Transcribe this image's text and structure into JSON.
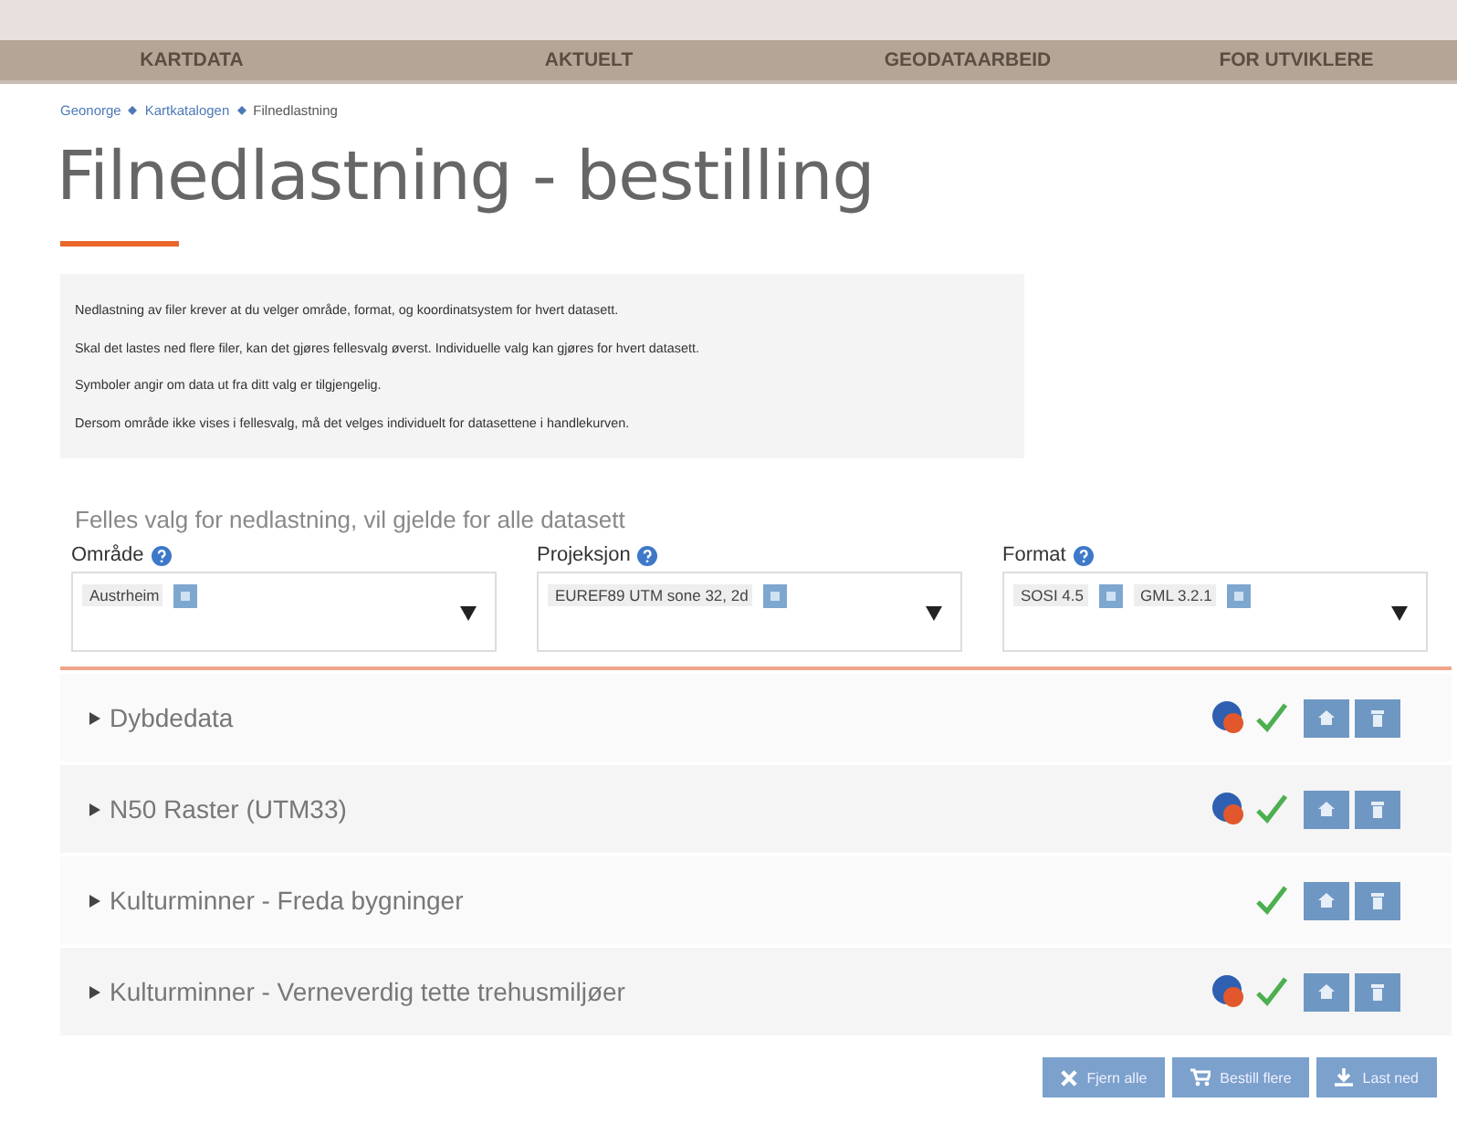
{
  "nav": [
    {
      "label": "KARTDATA"
    },
    {
      "label": "AKTUELT"
    },
    {
      "label": "GEODATAARBEID"
    },
    {
      "label": "FOR UTVIKLERE"
    }
  ],
  "breadcrumb": [
    {
      "label": "Geonorge",
      "kind": "link"
    },
    {
      "label": "Kartkatalogen",
      "kind": "link"
    },
    {
      "label": "Filnedlastning",
      "kind": "current"
    }
  ],
  "title": "Filnedlastning - bestilling",
  "info": [
    "Nedlastning av filer krever at du velger område, format, og koordinatsystem for hvert datasett.",
    "Skal det lastes ned flere filer, kan det gjøres fellesvalg øverst. Individuelle valg kan gjøres for hvert datasett.",
    "Symboler angir om data ut fra ditt valg er tilgjengelig.",
    "Dersom område ikke vises i fellesvalg, må det velges individuelt for datasettene i handlekurven."
  ],
  "common_heading": "Felles valg for nedlastning, vil gjelde for alle datasett",
  "selects": [
    {
      "label": "Område",
      "tags": [
        "Austrheim"
      ]
    },
    {
      "label": "Projeksjon",
      "tags": [
        "EUREF89 UTM sone 32, 2d"
      ]
    },
    {
      "label": "Format",
      "tags": [
        "SOSI 4.5",
        "GML 3.2.1"
      ]
    }
  ],
  "datasets": [
    {
      "name": "Dybdedata",
      "area_notice": true,
      "available": true
    },
    {
      "name": "N50 Raster (UTM33)",
      "area_notice": true,
      "available": true
    },
    {
      "name": "Kulturminner - Freda bygninger",
      "area_notice": false,
      "available": true
    },
    {
      "name": "Kulturminner - Verneverdig tette trehusmiljøer",
      "area_notice": true,
      "available": true
    }
  ],
  "actions": [
    {
      "label": "Fjern alle",
      "kind": "remove"
    },
    {
      "label": "Bestill flere",
      "kind": "cart"
    },
    {
      "label": "Last ned",
      "kind": "download"
    }
  ]
}
